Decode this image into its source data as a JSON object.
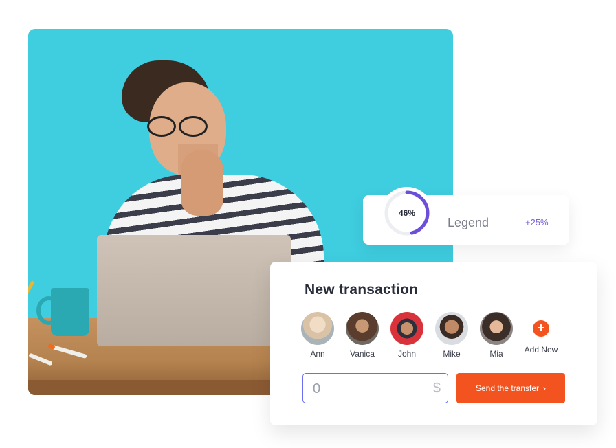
{
  "legend": {
    "percent_label": "46%",
    "percent_value": 0.46,
    "name": "Legend",
    "change": "+25%",
    "ring_color": "#6b4fd8"
  },
  "transaction": {
    "title": "New transaction",
    "contacts": [
      {
        "name": "Ann"
      },
      {
        "name": "Vanica"
      },
      {
        "name": "John"
      },
      {
        "name": "Mike"
      },
      {
        "name": "Mia"
      }
    ],
    "add_new_label": "Add New",
    "amount": {
      "value": "0",
      "currency_symbol": "$"
    },
    "send_button_label": "Send the transfer",
    "accent_color": "#f3541f"
  }
}
